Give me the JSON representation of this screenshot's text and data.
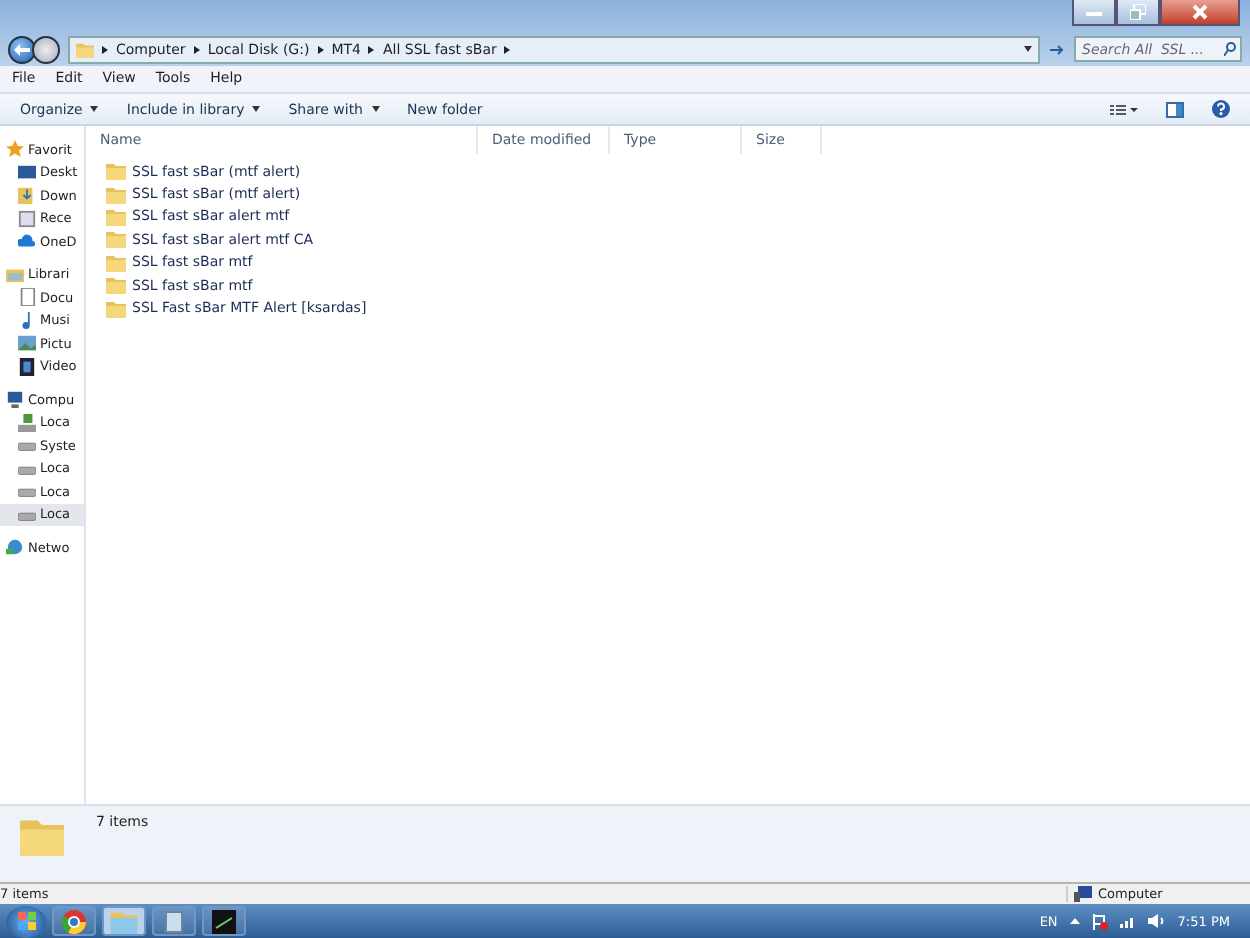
{
  "address_bar": {
    "crumbs": [
      "Computer",
      "Local Disk (G:)",
      "MT4",
      "All  SSL fast sBar"
    ]
  },
  "search": {
    "placeholder": "Search All  SSL ..."
  },
  "menu": [
    "File",
    "Edit",
    "View",
    "Tools",
    "Help"
  ],
  "toolbar": [
    {
      "label": "Organize",
      "dropdown": true
    },
    {
      "label": "Include in library",
      "dropdown": true
    },
    {
      "label": "Share with",
      "dropdown": true
    },
    {
      "label": "New folder",
      "dropdown": false
    }
  ],
  "sidebar": {
    "items": [
      {
        "kind": "group",
        "label": "Favorit",
        "selected": false
      },
      {
        "kind": "desktop",
        "label": "Deskt",
        "selected": false
      },
      {
        "kind": "downloads",
        "label": "Down",
        "selected": false
      },
      {
        "kind": "recent",
        "label": "Rece",
        "selected": false
      },
      {
        "kind": "cloud",
        "label": "OneD",
        "selected": false
      },
      {
        "kind": "library",
        "label": "Librari",
        "selected": false
      },
      {
        "kind": "document",
        "label": "Docu",
        "selected": false
      },
      {
        "kind": "music",
        "label": "Musi",
        "selected": false
      },
      {
        "kind": "picture",
        "label": "Pictu",
        "selected": false
      },
      {
        "kind": "video",
        "label": "Video",
        "selected": false
      },
      {
        "kind": "computer",
        "label": "Compu",
        "selected": false
      },
      {
        "kind": "system-drive",
        "label": "Loca",
        "selected": false
      },
      {
        "kind": "drive",
        "label": "Syste",
        "selected": false
      },
      {
        "kind": "drive",
        "label": "Loca",
        "selected": false
      },
      {
        "kind": "drive",
        "label": "Loca",
        "selected": false
      },
      {
        "kind": "drive",
        "label": "Loca",
        "selected": true
      },
      {
        "kind": "network",
        "label": "Netwo",
        "selected": false
      }
    ]
  },
  "table": {
    "columns": [
      "Name",
      "Date modified",
      "Type",
      "Size"
    ],
    "rows": [
      {
        "name": "SSL fast sBar (mtf alert)"
      },
      {
        "name": "SSL fast sBar (mtf alert)"
      },
      {
        "name": "SSL fast sBar alert mtf"
      },
      {
        "name": "SSL fast sBar alert mtf CA"
      },
      {
        "name": "SSL fast sBar mtf"
      },
      {
        "name": "SSL fast sBar mtf"
      },
      {
        "name": "SSL Fast sBar MTF Alert [ksardas]"
      }
    ]
  },
  "details_pane": {
    "text": "7 items"
  },
  "status_bar": {
    "left": "7 items",
    "right": "Computer"
  },
  "taskbar": {
    "apps": [
      {
        "kind": "browser",
        "selected": false
      },
      {
        "kind": "explorer",
        "selected": true
      },
      {
        "kind": "window",
        "selected": false
      },
      {
        "kind": "terminal",
        "selected": false
      }
    ],
    "language": "EN",
    "clock": "7:51 PM"
  }
}
